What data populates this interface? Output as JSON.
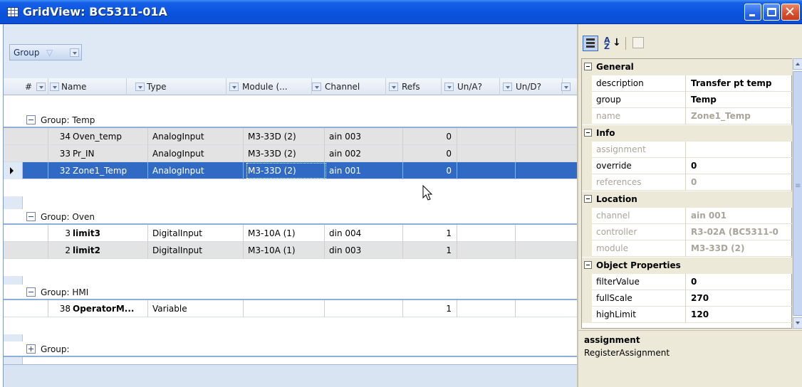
{
  "window": {
    "title": "GridView: BC5311-01A"
  },
  "groupby": {
    "chip_label": "Group"
  },
  "columns": [
    {
      "label": "#"
    },
    {
      "label": "Name"
    },
    {
      "label": "Type"
    },
    {
      "label": "Module (..."
    },
    {
      "label": "Channel"
    },
    {
      "label": "Refs"
    },
    {
      "label": "Un/A?"
    },
    {
      "label": "Un/D?"
    }
  ],
  "groups": [
    {
      "label": "Group: Temp",
      "rows": [
        {
          "num": "34",
          "name": "Oven_temp",
          "type": "AnalogInput",
          "module": "M3-33D (2)",
          "channel": "ain 003",
          "refs": "0"
        },
        {
          "num": "33",
          "name": "Pr_IN",
          "type": "AnalogInput",
          "module": "M3-33D (2)",
          "channel": "ain 002",
          "refs": "0"
        },
        {
          "num": "32",
          "name": "Zone1_Temp",
          "type": "AnalogInput",
          "module": "M3-33D (2)",
          "channel": "ain 001",
          "refs": "0"
        }
      ]
    },
    {
      "label": "Group: Oven",
      "rows": [
        {
          "num": "3",
          "name": "limit3",
          "type": "DigitalInput",
          "module": "M3-10A (1)",
          "channel": "din 004",
          "refs": "1"
        },
        {
          "num": "2",
          "name": "limit2",
          "type": "DigitalInput",
          "module": "M3-10A (1)",
          "channel": "din 003",
          "refs": "1"
        }
      ]
    },
    {
      "label": "Group: HMI",
      "rows": [
        {
          "num": "38",
          "name": "OperatorM...",
          "type": "Variable",
          "module": "",
          "channel": "",
          "refs": "1"
        }
      ]
    },
    {
      "label": "Group:",
      "rows": []
    }
  ],
  "properties": {
    "categories": [
      {
        "name": "General",
        "items": [
          {
            "name": "description",
            "value": "Transfer pt temp",
            "readonly": false
          },
          {
            "name": "group",
            "value": "Temp",
            "readonly": false
          },
          {
            "name": "name",
            "value": "Zone1_Temp",
            "readonly": true
          }
        ]
      },
      {
        "name": "Info",
        "items": [
          {
            "name": "assignment",
            "value": "",
            "readonly": true
          },
          {
            "name": "override",
            "value": "0",
            "readonly": false
          },
          {
            "name": "references",
            "value": "0",
            "readonly": true
          }
        ]
      },
      {
        "name": "Location",
        "items": [
          {
            "name": "channel",
            "value": "ain 001",
            "readonly": true
          },
          {
            "name": "controller",
            "value": "R3-02A (BC5311-0",
            "readonly": true
          },
          {
            "name": "module",
            "value": "M3-33D (2)",
            "readonly": true
          }
        ]
      },
      {
        "name": "Object Properties",
        "items": [
          {
            "name": "filterValue",
            "value": "0",
            "readonly": false
          },
          {
            "name": "fullScale",
            "value": "270",
            "readonly": false
          },
          {
            "name": "highLimit",
            "value": "120",
            "readonly": false
          }
        ]
      }
    ],
    "description": {
      "title": "assignment",
      "text": "RegisterAssignment"
    }
  },
  "icons": {
    "app": "grid-icon",
    "minimize": "minimize-icon",
    "maximize": "maximize-icon",
    "close": "close-icon",
    "categorized": "categorized-icon",
    "alphabetical": "sort-az-icon",
    "pages": "property-pages-icon",
    "filter": "funnel-icon",
    "dropdown": "dropdown-arrow-icon",
    "cursor": "mouse-pointer-icon"
  },
  "colors": {
    "titlebar": "#0a53df",
    "selection": "#316ac5",
    "header": "#dfe8f5",
    "alt_row": "#e3e3e3"
  }
}
